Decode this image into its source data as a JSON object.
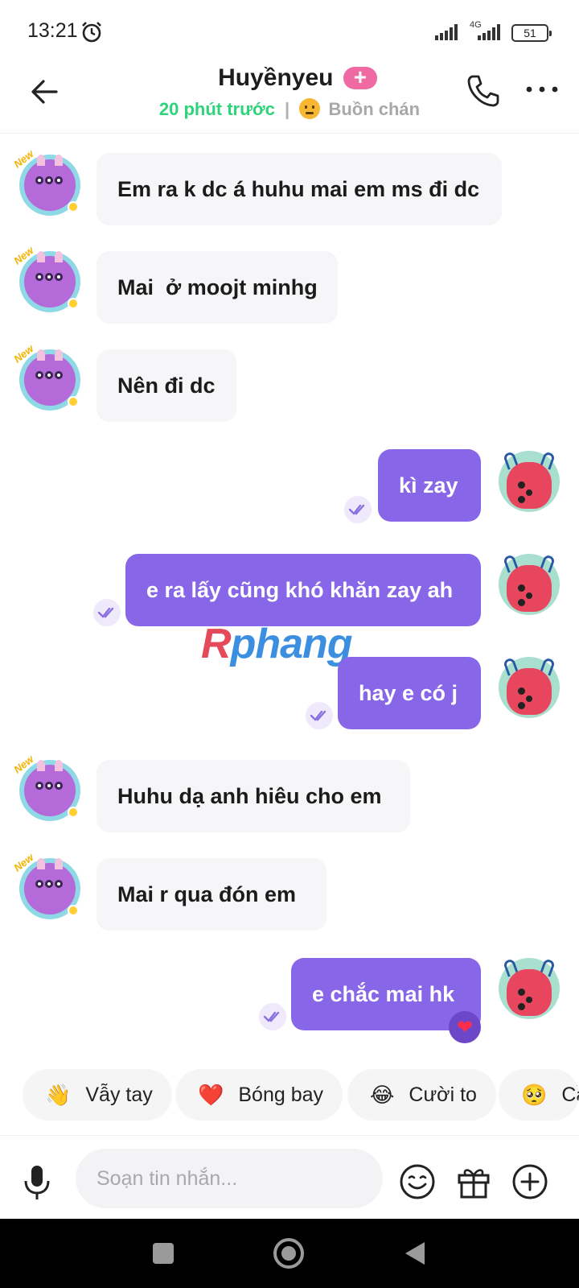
{
  "status_bar": {
    "time": "13:21",
    "network": "4G",
    "battery": "51"
  },
  "header": {
    "contact_name": "Huyềnyeu",
    "add_badge": "+",
    "last_seen": "20 phút trước",
    "separator": "|",
    "mood": "Buồn chán"
  },
  "messages": [
    {
      "side": "in",
      "text": "Em ra k dc á huhu mai em ms đi dc"
    },
    {
      "side": "in",
      "text": "Mai  ở moojt minhg"
    },
    {
      "side": "in",
      "text": "Nên đi dc"
    },
    {
      "side": "out",
      "text": "kì zay"
    },
    {
      "side": "out",
      "text": "e ra lấy cũng khó khăn zay ah"
    },
    {
      "side": "out",
      "text": "hay e có j"
    },
    {
      "side": "in",
      "text": "Huhu dạ anh hiêu cho em"
    },
    {
      "side": "in",
      "text": "Mai r qua đón em"
    },
    {
      "side": "out",
      "text": "e chắc mai hk",
      "reaction": "heart"
    }
  ],
  "avatar_badge": "New",
  "watermark": {
    "part1": "R",
    "part2": "phang"
  },
  "quick_replies": [
    {
      "emoji": "👋",
      "label": "Vẫy tay"
    },
    {
      "emoji": "❤️",
      "label": "Bóng bay"
    },
    {
      "emoji": "😂",
      "label": "Cười to"
    },
    {
      "emoji": "🥺",
      "label": "Cầ"
    }
  ],
  "composer": {
    "placeholder": "Soạn tin nhắn..."
  },
  "colors": {
    "outgoing_bubble": "#8866e8",
    "incoming_bubble": "#f6f6f8",
    "presence_green": "#2ed47a",
    "badge_pink": "#ef6aa3"
  }
}
